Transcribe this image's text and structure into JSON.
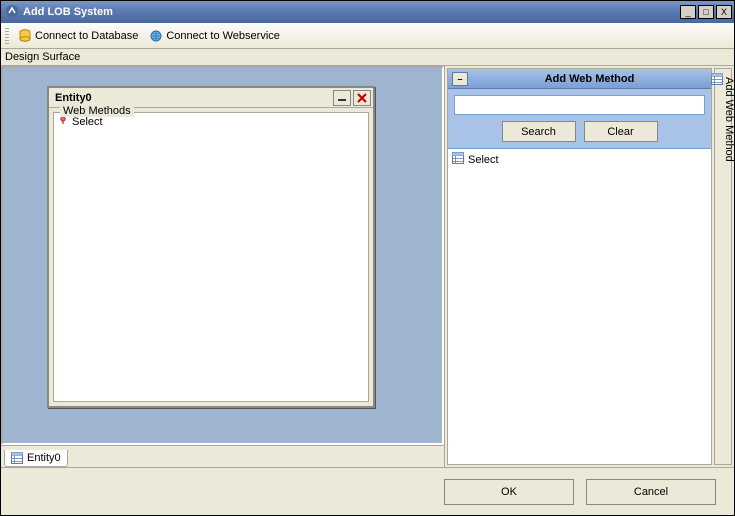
{
  "window": {
    "title": "Add LOB System",
    "min_label": "_",
    "max_label": "□",
    "close_label": "X"
  },
  "toolbar": {
    "connect_db": "Connect to Database",
    "connect_ws": "Connect to Webservice"
  },
  "design": {
    "label": "Design Surface",
    "entity": {
      "title": "Entity0",
      "group_label": "Web Methods",
      "items": [
        "Select"
      ]
    },
    "tab_label": "Entity0"
  },
  "panel": {
    "title": "Add Web Method",
    "collapse_glyph": "–",
    "search_value": "",
    "search_placeholder": "",
    "search_btn": "Search",
    "clear_btn": "Clear",
    "results": [
      "Select"
    ],
    "sidebar_tab": "Add Web Method"
  },
  "footer": {
    "ok": "OK",
    "cancel": "Cancel"
  }
}
